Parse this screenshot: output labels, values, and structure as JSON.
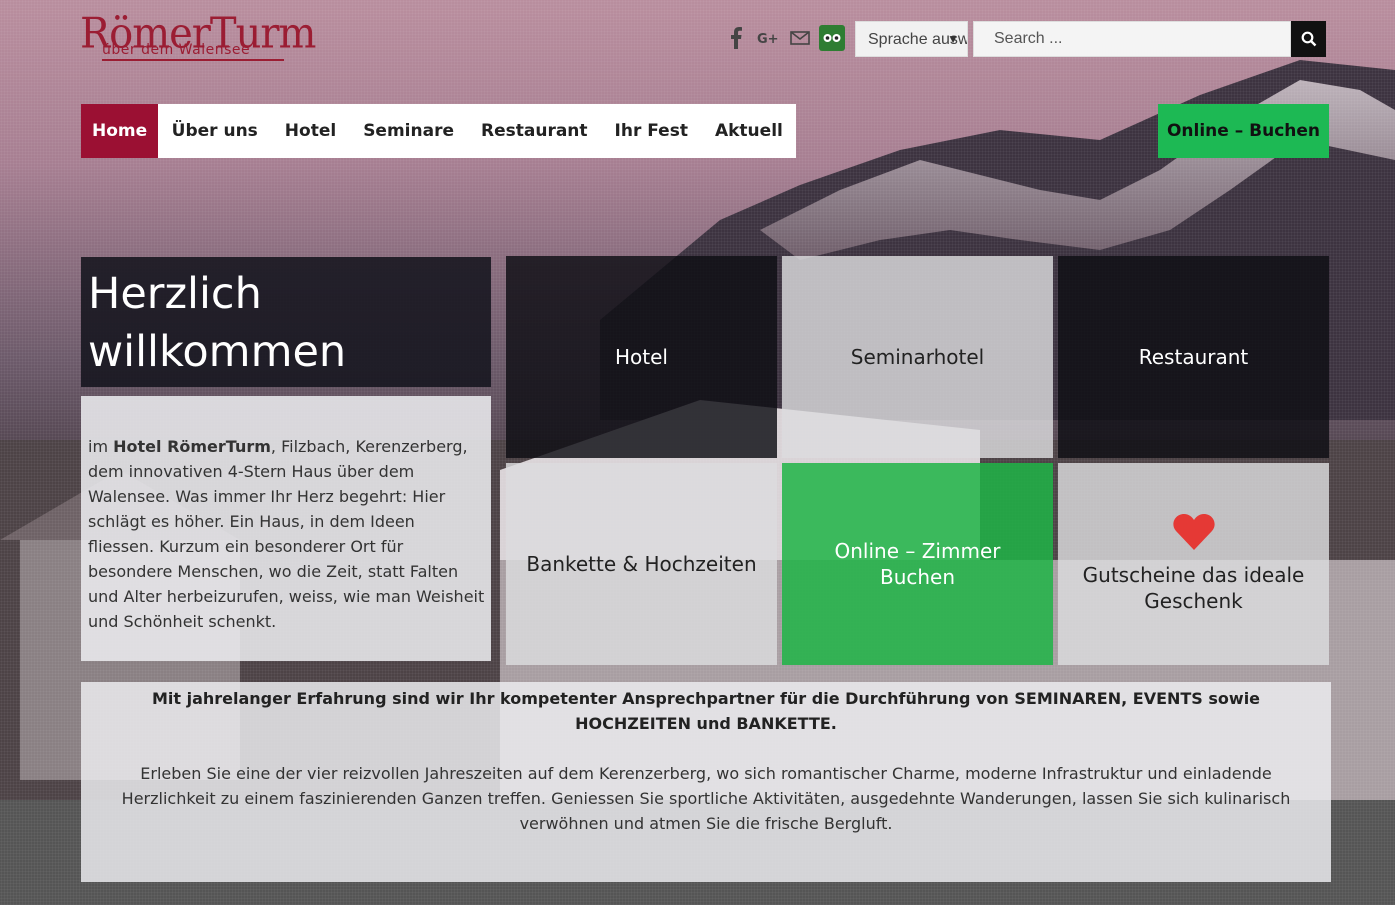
{
  "brand": {
    "logo_main": "RömerTurm",
    "logo_sub": "über dem Walensee",
    "accent": "#9b1033",
    "green": "#1db954"
  },
  "header": {
    "social_icons": [
      "facebook-icon",
      "google-plus-icon",
      "mail-icon",
      "tripadvisor-icon"
    ],
    "language_placeholder": "Sprache auswählen",
    "search_placeholder": "Search ..."
  },
  "nav": {
    "items": [
      {
        "label": "Home",
        "active": true
      },
      {
        "label": "Über uns"
      },
      {
        "label": "Hotel"
      },
      {
        "label": "Seminare"
      },
      {
        "label": "Restaurant"
      },
      {
        "label": "Ihr Fest"
      },
      {
        "label": "Aktuell"
      }
    ],
    "book_label": "Online – Buchen"
  },
  "welcome": {
    "title": "Herzlich willkommen",
    "intro_prefix": "im ",
    "intro_bold": "Hotel RömerTurm",
    "intro_rest": ", Filzbach, Kerenzerberg, dem innovativen 4-Stern Haus über dem Walensee. Was immer Ihr Herz begehrt: Hier schlägt es höher. Ein Haus, in dem Ideen fliessen. Kurzum ein besonderer Ort für besondere Menschen, wo die Zeit, statt Falten und Alter herbeizurufen, weiss, wie man Weisheit und Schönheit schenkt."
  },
  "tiles": [
    {
      "label": "Hotel",
      "style": "dark"
    },
    {
      "label": "Seminarhotel",
      "style": "light"
    },
    {
      "label": "Restaurant",
      "style": "dark"
    },
    {
      "label": "Bankette & Hochzeiten",
      "style": "light"
    },
    {
      "label": "Online – Zimmer Buchen",
      "style": "green"
    },
    {
      "label": "Gutscheine das ideale Geschenk",
      "style": "light",
      "icon": "heart-icon"
    }
  ],
  "bottom": {
    "lead": "Mit jahrelanger Erfahrung sind wir Ihr kompetenter Ansprechpartner für die Durchführung von SEMINAREN, EVENTS sowie HOCHZEITEN und BANKETTE.",
    "text": "Erleben Sie eine der vier reizvollen Jahreszeiten auf dem Kerenzerberg, wo sich romantischer Charme, moderne Infrastruktur und einladende Herzlichkeit zu einem faszinierenden Ganzen treffen. Geniessen Sie sportliche Aktivitäten, ausgedehnte Wanderungen, lassen Sie sich kulinarisch verwöhnen und atmen Sie die frische Bergluft."
  }
}
